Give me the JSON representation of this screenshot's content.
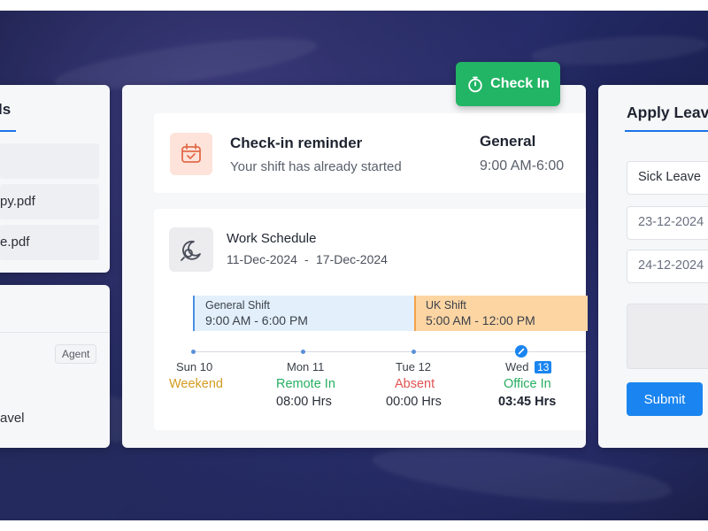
{
  "left_panel": {
    "title_fragment": "ls",
    "files": [
      "py.pdf",
      "e.pdf"
    ],
    "tag": "Agent",
    "list_item": "avel"
  },
  "check_in_button": {
    "label": "Check In",
    "icon": "stopwatch-icon"
  },
  "reminder": {
    "title": "Check-in reminder",
    "subtitle": "Your shift has already started",
    "shift_name": "General",
    "shift_time": "9:00 AM-6:00",
    "icon": "calendar-icon"
  },
  "schedule": {
    "title": "Work Schedule",
    "start": "11-Dec-2024",
    "separator": "-",
    "end": "17-Dec-2024",
    "icon": "moon-sun-icon",
    "shifts": [
      {
        "name": "General Shift",
        "time": "9:00 AM - 6:00 PM",
        "color": "#e3f0fc",
        "border": "#4a90e2"
      },
      {
        "name": "UK Shift",
        "time": "5:00 AM - 12:00 PM",
        "color": "#fcd5a3",
        "border": "#f0a34a"
      }
    ],
    "days": [
      {
        "name": "Sun",
        "date": "10",
        "status": "Weekend",
        "status_color": "#d49b1f",
        "hours": ""
      },
      {
        "name": "Mon",
        "date": "11",
        "status": "Remote In",
        "status_color": "#27ae60",
        "hours": "08:00 Hrs"
      },
      {
        "name": "Tue",
        "date": "12",
        "status": "Absent",
        "status_color": "#e05252",
        "hours": "00:00 Hrs"
      },
      {
        "name": "Wed",
        "date": "13",
        "status": "Office In",
        "status_color": "#27ae60",
        "hours": "03:45 Hrs",
        "today": true
      }
    ]
  },
  "apply_leave": {
    "title": "Apply Leav",
    "leave_type": "Sick Leave",
    "from_date": "23-12-2024",
    "to_date": "24-12-2024",
    "submit_label": "Submit"
  },
  "colors": {
    "accent": "#1a85f0",
    "success": "#22b565",
    "background": "#1d2355"
  }
}
